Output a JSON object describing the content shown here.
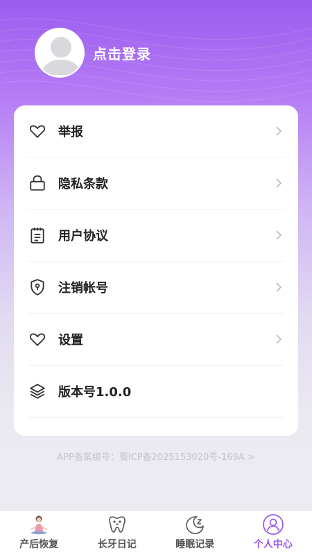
{
  "header": {
    "login_label": "点击登录"
  },
  "menu": [
    {
      "label": "举报",
      "icon": "heart-icon"
    },
    {
      "label": "隐私条款",
      "icon": "lock-icon"
    },
    {
      "label": "用户协议",
      "icon": "clipboard-icon"
    },
    {
      "label": "注销帐号",
      "icon": "shield-icon"
    },
    {
      "label": "设置",
      "icon": "heart-icon"
    },
    {
      "label": "版本号1.0.0",
      "icon": "layers-icon"
    }
  ],
  "footer": {
    "record_text": "APP备案编号：蜀ICP备2025153020号-169A >"
  },
  "tabs": [
    {
      "label": "产后恢复",
      "icon": "yoga-icon"
    },
    {
      "label": "长牙日记",
      "icon": "tooth-icon"
    },
    {
      "label": "睡眠记录",
      "icon": "moon-sleep-icon"
    },
    {
      "label": "个人中心",
      "icon": "person-icon",
      "active": true
    }
  ],
  "colors": {
    "accent": "#9a55ef",
    "gradient_top": "#9b5cf0"
  }
}
